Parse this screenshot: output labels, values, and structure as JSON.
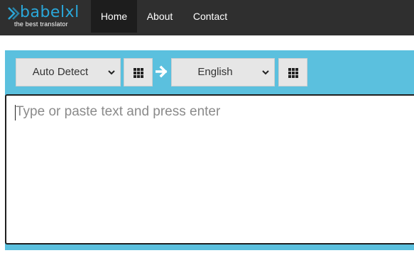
{
  "brand": {
    "name": "babelxl",
    "tagline": "the best translator",
    "accent_color": "#2aa7d9"
  },
  "nav": {
    "items": [
      {
        "label": "Home",
        "active": true
      },
      {
        "label": "About",
        "active": false
      },
      {
        "label": "Contact",
        "active": false
      }
    ]
  },
  "translator": {
    "source_language": "Auto Detect",
    "target_language": "English",
    "swap_icon": "arrow-right-icon",
    "grid_icon": "grid-icon",
    "input": {
      "value": "",
      "placeholder": "Type or paste text and press enter"
    },
    "panel_color": "#5bc0de"
  }
}
